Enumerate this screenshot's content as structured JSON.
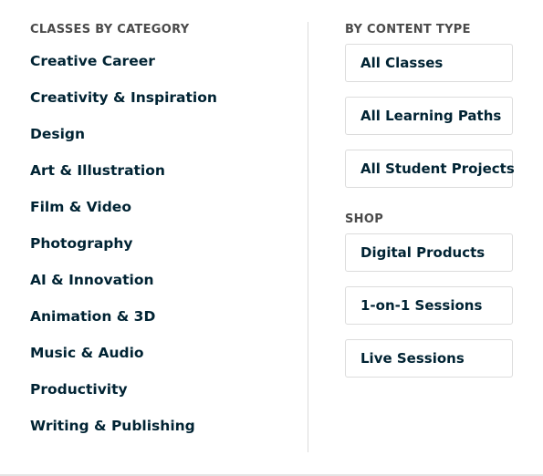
{
  "left_column": {
    "heading": "CLASSES BY CATEGORY",
    "categories": [
      "Creative Career",
      "Creativity & Inspiration",
      "Design",
      "Art & Illustration",
      "Film & Video",
      "Photography",
      "AI & Innovation",
      "Animation & 3D",
      "Music & Audio",
      "Productivity",
      "Writing & Publishing"
    ]
  },
  "right_column": {
    "content_type": {
      "heading": "BY CONTENT TYPE",
      "buttons": [
        "All Classes",
        "All Learning Paths",
        "All Student Projects"
      ]
    },
    "shop": {
      "heading": "SHOP",
      "buttons": [
        "Digital Products",
        "1-on-1 Sessions",
        "Live Sessions"
      ]
    }
  },
  "colors": {
    "text_primary": "#002333",
    "heading": "#4a4a4a",
    "border": "#dcdcdc"
  }
}
